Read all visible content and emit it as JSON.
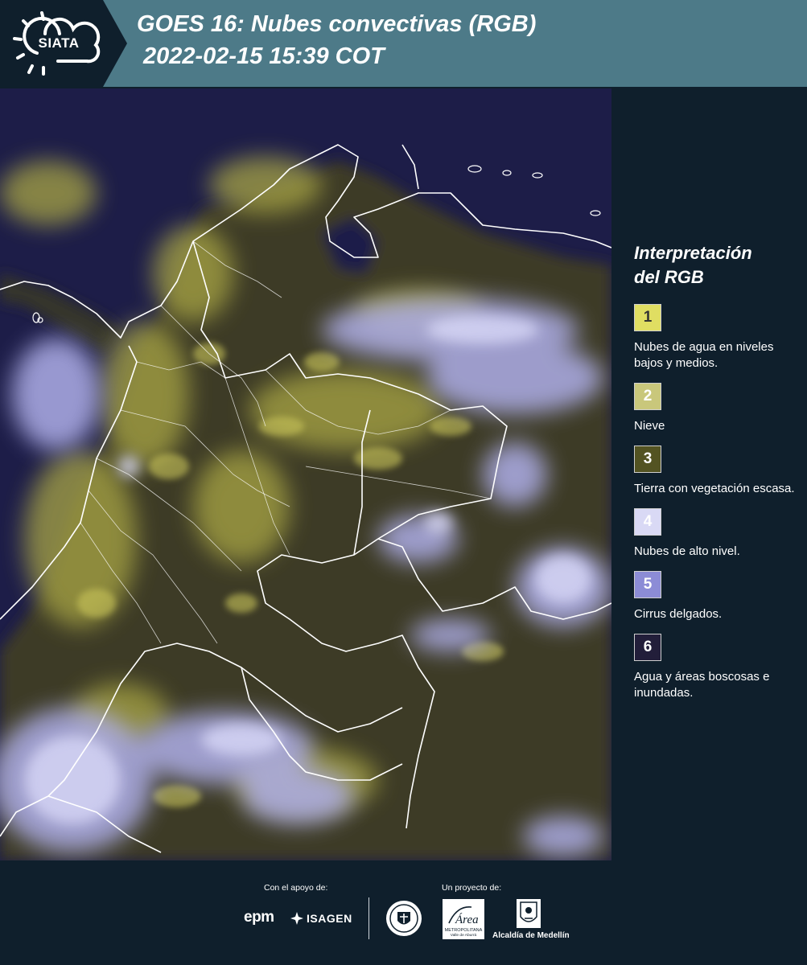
{
  "header": {
    "logo_text": "SIATA",
    "title_line1": "GOES 16: Nubes convectivas (RGB)",
    "title_line2": "2022-02-15 15:39 COT",
    "colors": {
      "dark": "#0f1f2c",
      "teal": "#4d7a88"
    }
  },
  "legend": {
    "title_line1": "Interpretación",
    "title_line2": "del RGB",
    "items": [
      {
        "number": "1",
        "label": "Nubes de agua en niveles bajos y medios.",
        "color": "#e0de62",
        "text_color": "#333333"
      },
      {
        "number": "2",
        "label": "Nieve",
        "color": "#c9c77b",
        "text_color": "#ffffff"
      },
      {
        "number": "3",
        "label": "Tierra con vegetación escasa.",
        "color": "#535322",
        "text_color": "#ffffff"
      },
      {
        "number": "4",
        "label": "Nubes de alto nivel.",
        "color": "#d9d9f5",
        "text_color": "#ffffff"
      },
      {
        "number": "5",
        "label": "Cirrus delgados.",
        "color": "#8c8cd6",
        "text_color": "#ffffff"
      },
      {
        "number": "6",
        "label": "Agua y áreas boscosas e inundadas.",
        "color": "#221e3a",
        "text_color": "#ffffff"
      }
    ]
  },
  "footer": {
    "support_label": "Con el apoyo de:",
    "project_label": "Un proyecto de:",
    "epm_text": "epm",
    "isagen_text": "ISAGEN",
    "area_text": "Área",
    "area_sub1": "METROPOLITANA",
    "area_sub2": "Valle de Aburrá",
    "medellin_text": "Alcaldía de Medellín"
  },
  "map": {
    "colors": {
      "background": "#1d1d48",
      "land": "#3f3d25",
      "low_clouds": "#b9b64c",
      "high_clouds": "#b8b8ee",
      "borders": "#ffffff"
    }
  }
}
